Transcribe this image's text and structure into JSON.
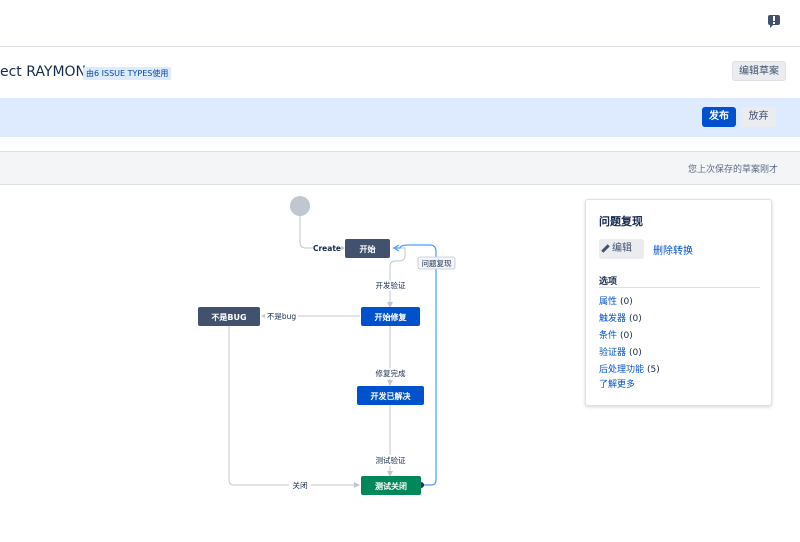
{
  "header": {
    "feedback_icon": "feedback-icon"
  },
  "title_row": {
    "project_title": "ect RAYMON",
    "issue_badge": "由6 ISSUE TYPES使用",
    "edit_draft_label": "编辑草案"
  },
  "banner": {
    "publish_label": "发布",
    "discard_label": "放弃"
  },
  "toolbar": {
    "saved_text": "您上次保存的草案刚才"
  },
  "diagram": {
    "statuses": [
      {
        "id": "start",
        "label": "开始",
        "category": "todo",
        "color": "#42526e"
      },
      {
        "id": "fixing",
        "label": "开始修复",
        "category": "in-progress",
        "color": "#0052cc"
      },
      {
        "id": "not_bug",
        "label": "不是BUG",
        "category": "todo",
        "color": "#42526e"
      },
      {
        "id": "resolved",
        "label": "开发已解决",
        "category": "in-progress",
        "color": "#0052cc"
      },
      {
        "id": "closed",
        "label": "测试关闭",
        "category": "done",
        "color": "#00875a"
      }
    ],
    "transitions": [
      {
        "label": "Create",
        "from": "initial",
        "to": "start"
      },
      {
        "label": "开发验证",
        "from": "start",
        "to": "fixing"
      },
      {
        "label": "不是bug",
        "from": "fixing",
        "to": "not_bug"
      },
      {
        "label": "修复完成",
        "from": "fixing",
        "to": "resolved"
      },
      {
        "label": "测试验证",
        "from": "resolved",
        "to": "closed"
      },
      {
        "label": "关闭",
        "from": "not_bug",
        "to": "closed"
      },
      {
        "label": "问题复现",
        "from": "closed",
        "to": "start",
        "selected": true
      }
    ],
    "line_color": "#c1c7d0",
    "selected_line_color": "#4c9aff"
  },
  "panel": {
    "title": "问题复现",
    "edit_label": "编辑",
    "delete_label": "删除转换",
    "section_label": "选项",
    "options": [
      {
        "label": "属性",
        "count": "(0)"
      },
      {
        "label": "触发器",
        "count": "(0)"
      },
      {
        "label": "条件",
        "count": "(0)"
      },
      {
        "label": "验证器",
        "count": "(0)"
      },
      {
        "label": "后处理功能",
        "count": "(5)"
      }
    ],
    "learn_more": "了解更多"
  }
}
